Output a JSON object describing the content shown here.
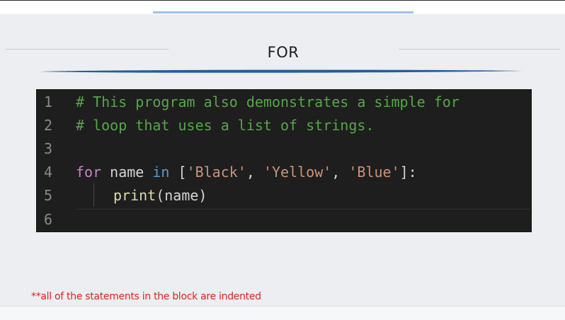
{
  "slide": {
    "title": "FOR",
    "footnote": "**all of the statements in the block are indented"
  },
  "code": {
    "lines": [
      {
        "number": "1",
        "tokens": [
          "# This program also demonstrates a simple for"
        ]
      },
      {
        "number": "2",
        "tokens": [
          "# loop that uses a list of strings."
        ]
      },
      {
        "number": "3",
        "tokens": []
      },
      {
        "number": "4",
        "tokens": [
          "for",
          " name ",
          "in",
          " [",
          "'Black'",
          ", ",
          "'Yellow'",
          ", ",
          "'Blue'",
          "]:"
        ]
      },
      {
        "number": "5",
        "tokens": [
          "print",
          "(name)"
        ]
      },
      {
        "number": "6",
        "tokens": []
      }
    ]
  },
  "colors": {
    "comment": "#57a64a",
    "keyword": "#c586c0",
    "in_keyword": "#569cd6",
    "string": "#ce9178",
    "function": "#dcdcaa",
    "footnote": "#e0241b",
    "title_underline": "#1f5fa0"
  }
}
